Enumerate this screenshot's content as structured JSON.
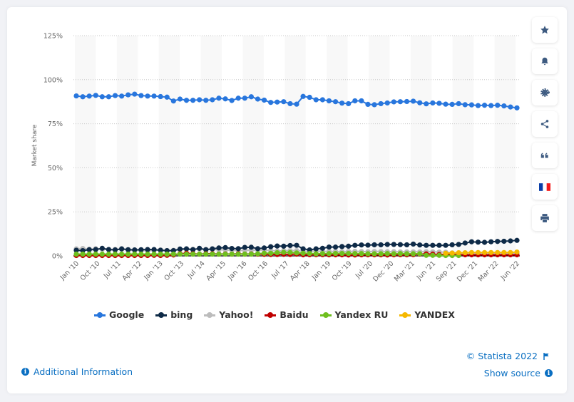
{
  "sidebar": {
    "buttons": [
      {
        "name": "favorite",
        "icon": "star-icon"
      },
      {
        "name": "notification",
        "icon": "bell-icon"
      },
      {
        "name": "settings",
        "icon": "gear-icon"
      },
      {
        "name": "share",
        "icon": "share-icon"
      },
      {
        "name": "cite",
        "icon": "quote-icon"
      },
      {
        "name": "language",
        "icon": "french-flag-icon"
      },
      {
        "name": "print",
        "icon": "printer-icon"
      }
    ]
  },
  "footer": {
    "additional_info": "Additional Information",
    "copyright": "© Statista 2022",
    "show_source": "Show source"
  },
  "colors": {
    "link": "#0a6fc2",
    "icon": "#3d5a80"
  },
  "chart_data": {
    "type": "line",
    "title": "",
    "xlabel": "",
    "ylabel": "Market share",
    "ylim": [
      0,
      125
    ],
    "yticks": [
      0,
      25,
      50,
      75,
      100,
      125
    ],
    "ytick_labels": [
      "0%",
      "25%",
      "50%",
      "75%",
      "100%",
      "125%"
    ],
    "grid": true,
    "legend_position": "bottom",
    "xtick_labels": [
      "Jan '10",
      "Oct '10",
      "Jul '11",
      "Apr '12",
      "Jan '13",
      "Oct '13",
      "Jul '14",
      "Apr '15",
      "Jan '16",
      "Oct '16",
      "Jul '17",
      "Apr '18",
      "Jan '19",
      "Oct '19",
      "Jul '20",
      "Dec '20",
      "Mar '21",
      "Jun '21",
      "Sep '21",
      "Dec '21",
      "Mar '22",
      "Jun '22"
    ],
    "series": [
      {
        "name": "Google",
        "color": "#2876dd",
        "values": [
          90.8,
          90.3,
          90.7,
          91.1,
          90.3,
          90.3,
          91.0,
          90.7,
          91.4,
          91.8,
          91.0,
          90.7,
          90.7,
          90.4,
          90.1,
          87.9,
          89.0,
          88.3,
          88.3,
          88.6,
          88.3,
          88.6,
          89.5,
          89.1,
          88.2,
          89.5,
          89.5,
          90.3,
          89.0,
          88.4,
          87.1,
          87.3,
          87.5,
          86.4,
          86.1,
          90.5,
          90.0,
          88.6,
          88.6,
          88.0,
          87.5,
          86.7,
          86.4,
          88.0,
          88.0,
          86.0,
          85.8,
          86.4,
          86.8,
          87.4,
          87.5,
          87.6,
          87.8,
          86.9,
          86.3,
          86.8,
          86.6,
          86.1,
          86.0,
          86.4,
          85.8,
          85.7,
          85.3,
          85.5,
          85.3,
          85.5,
          85.1,
          84.5,
          84.0
        ]
      },
      {
        "name": "bing",
        "color": "#0e2a47",
        "values": [
          3.2,
          3.0,
          3.5,
          3.6,
          4.3,
          3.6,
          3.4,
          4.0,
          3.5,
          3.4,
          3.5,
          3.6,
          3.6,
          3.2,
          3.0,
          3.0,
          3.9,
          4.0,
          3.5,
          4.3,
          3.5,
          4.0,
          4.5,
          4.7,
          4.2,
          4.1,
          4.8,
          4.9,
          4.1,
          4.5,
          5.2,
          5.6,
          5.5,
          5.9,
          6.0,
          4.0,
          3.4,
          4.0,
          4.3,
          5.0,
          5.0,
          5.3,
          5.5,
          6.0,
          6.2,
          6.1,
          6.3,
          6.3,
          6.5,
          6.5,
          6.4,
          6.3,
          6.7,
          6.2,
          6.0,
          6.0,
          6.0,
          6.0,
          6.3,
          6.5,
          7.3,
          8.0,
          7.8,
          7.7,
          8.0,
          8.2,
          8.3,
          8.5,
          8.8
        ]
      },
      {
        "name": "Yahoo!",
        "color": "#bcbcbc",
        "values": [
          4.0,
          4.2,
          3.8,
          4.1,
          3.7,
          3.6,
          3.7,
          3.7,
          3.5,
          3.2,
          3.0,
          3.0,
          3.0,
          3.4,
          3.0,
          3.2,
          3.5,
          3.7,
          3.8,
          3.9,
          3.7,
          3.7,
          3.5,
          3.3,
          3.2,
          3.0,
          3.1,
          3.2,
          3.3,
          3.2,
          3.0,
          2.8,
          2.9,
          3.0,
          3.0,
          2.6,
          2.7,
          2.7,
          2.6,
          2.5,
          2.5,
          2.4,
          2.5,
          2.6,
          2.5,
          2.4,
          2.5,
          2.5,
          2.4,
          2.4,
          2.3,
          2.3,
          2.3,
          2.3,
          2.4,
          2.3,
          2.2,
          2.1,
          1.7,
          1.6,
          1.5,
          1.4,
          1.4,
          1.4,
          1.5,
          1.4,
          1.4,
          1.3,
          1.3
        ]
      },
      {
        "name": "Baidu",
        "color": "#c00000",
        "values": [
          0.2,
          0.2,
          0.2,
          0.2,
          0.2,
          0.2,
          0.2,
          0.2,
          0.2,
          0.2,
          0.2,
          0.2,
          0.3,
          0.2,
          0.3,
          0.5,
          1.2,
          1.5,
          1.2,
          1.0,
          1.2,
          1.2,
          1.0,
          1.1,
          1.0,
          1.2,
          1.0,
          1.1,
          1.0,
          0.9,
          0.8,
          0.8,
          0.9,
          0.8,
          1.0,
          0.6,
          0.7,
          0.7,
          0.7,
          0.6,
          0.6,
          0.6,
          0.5,
          0.5,
          0.6,
          0.6,
          0.6,
          0.6,
          0.5,
          0.6,
          0.7,
          0.6,
          0.7,
          1.0,
          1.1,
          1.0,
          0.8,
          0.9,
          0.8,
          0.7,
          0.6,
          0.6,
          0.6,
          0.6,
          0.6,
          0.6,
          0.6,
          0.6,
          0.6
        ]
      },
      {
        "name": "Yandex RU",
        "color": "#6fbf1f",
        "values": [
          1.0,
          1.0,
          1.0,
          1.0,
          1.0,
          1.0,
          1.0,
          1.0,
          1.0,
          1.0,
          1.0,
          1.0,
          1.0,
          1.0,
          1.0,
          1.0,
          1.0,
          1.0,
          1.0,
          1.0,
          1.0,
          1.0,
          1.0,
          1.0,
          1.0,
          1.0,
          1.0,
          1.0,
          1.2,
          1.5,
          1.5,
          1.8,
          2.0,
          1.9,
          1.7,
          1.5,
          1.4,
          1.2,
          1.3,
          1.3,
          1.4,
          1.4,
          1.4,
          1.3,
          1.3,
          1.2,
          1.2,
          1.2,
          1.3,
          1.2,
          1.3,
          1.2,
          1.2,
          1.2,
          0.3,
          0.3,
          0.3,
          0.2,
          0.2,
          0.2,
          null,
          null,
          null,
          null,
          null,
          null,
          null,
          null,
          null
        ]
      },
      {
        "name": "YANDEX",
        "color": "#f5b800",
        "values": [
          null,
          null,
          null,
          null,
          null,
          null,
          null,
          null,
          null,
          null,
          null,
          null,
          null,
          null,
          null,
          null,
          null,
          null,
          null,
          null,
          null,
          null,
          null,
          null,
          null,
          null,
          null,
          null,
          null,
          null,
          null,
          null,
          null,
          null,
          null,
          null,
          null,
          null,
          null,
          null,
          null,
          null,
          null,
          null,
          null,
          null,
          null,
          null,
          null,
          null,
          null,
          null,
          null,
          null,
          null,
          null,
          null,
          1.5,
          1.6,
          1.8,
          1.8,
          1.9,
          1.9,
          1.9,
          1.9,
          1.9,
          1.9,
          1.9,
          2.2
        ]
      }
    ]
  }
}
